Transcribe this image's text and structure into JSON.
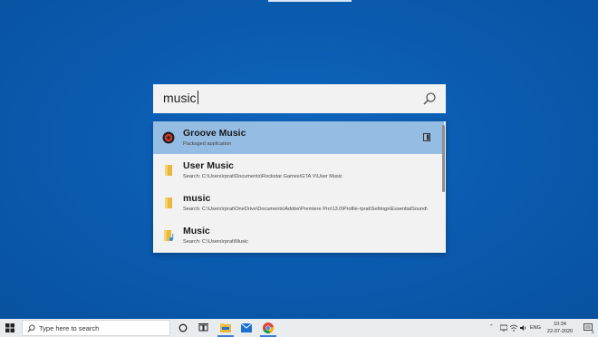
{
  "search": {
    "query": "music"
  },
  "results": [
    {
      "title": "Groove Music",
      "subtitle": "Packaged application",
      "icon": "groove-music-icon",
      "selected": true
    },
    {
      "title": "User Music",
      "subtitle": "Search: C:\\Users\\rprat\\Documents\\Rockstar Games\\GTA V\\User Music",
      "icon": "folder-icon",
      "selected": false
    },
    {
      "title": "music",
      "subtitle": "Search: C:\\Users\\rprat\\OneDrive\\Documents\\Adobe\\Premiere Pro\\13.0\\Profile-rprat\\Settings\\EssentialSound\\",
      "icon": "folder-icon",
      "selected": false
    },
    {
      "title": "Music",
      "subtitle": "Search: C:\\Users\\rprat\\Music",
      "icon": "music-folder-icon",
      "selected": false
    }
  ],
  "taskbar": {
    "search_placeholder": "Type here to search",
    "language": "ENG",
    "time": "10:34",
    "date": "22-07-2020",
    "notification_count": "2"
  },
  "colors": {
    "desktop": "#0a5bb0",
    "selected_row": "#95bde4",
    "taskbar": "#e9ecef"
  }
}
